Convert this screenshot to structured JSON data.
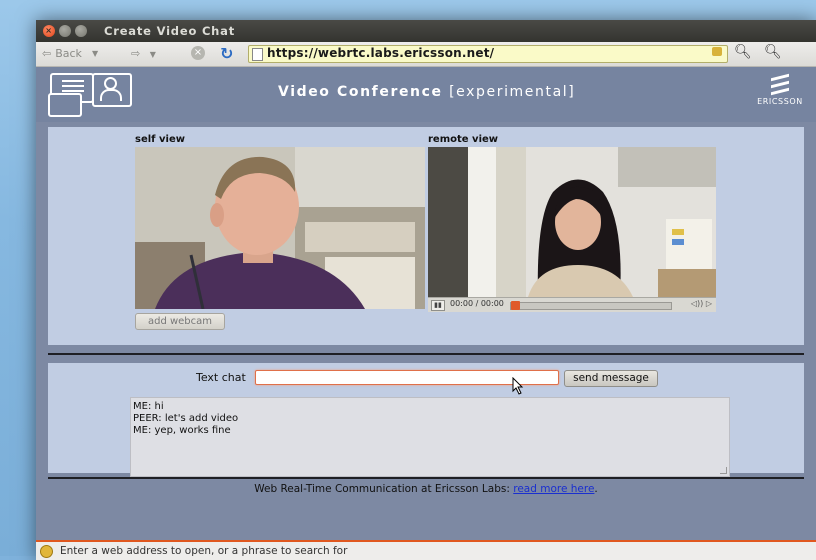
{
  "window": {
    "title": "Create Video Chat"
  },
  "nav": {
    "back_label": "Back",
    "url": "https://webrtc.labs.ericsson.net/",
    "icons": [
      "back-arrow-icon",
      "forward-arrow-icon",
      "stop-icon",
      "reload-icon",
      "lock-icon",
      "zoom-in-icon",
      "zoom-out-icon"
    ]
  },
  "header": {
    "title": "Video Conference",
    "subtitle": "[experimental]",
    "brand": "ERICSSON"
  },
  "video": {
    "self_label": "self view",
    "remote_label": "remote view",
    "time_display": "00:00 / 00:00",
    "add_webcam_label": "add webcam"
  },
  "chat": {
    "label": "Text chat",
    "input_value": "",
    "send_label": "send message",
    "messages": [
      "ME: hi",
      "PEER: let's add video",
      "ME: yep, works fine"
    ]
  },
  "footer": {
    "text": "Web Real-Time Communication at Ericsson Labs:",
    "link_label": "read more here",
    "trailing": "."
  },
  "status": {
    "text": "Enter a web address to open, or a phrase to search for"
  },
  "colors": {
    "accent": "#e0581f",
    "page_bg": "#7d89a3",
    "panel_bg": "#c1cde3",
    "link": "#1a2fcf"
  }
}
